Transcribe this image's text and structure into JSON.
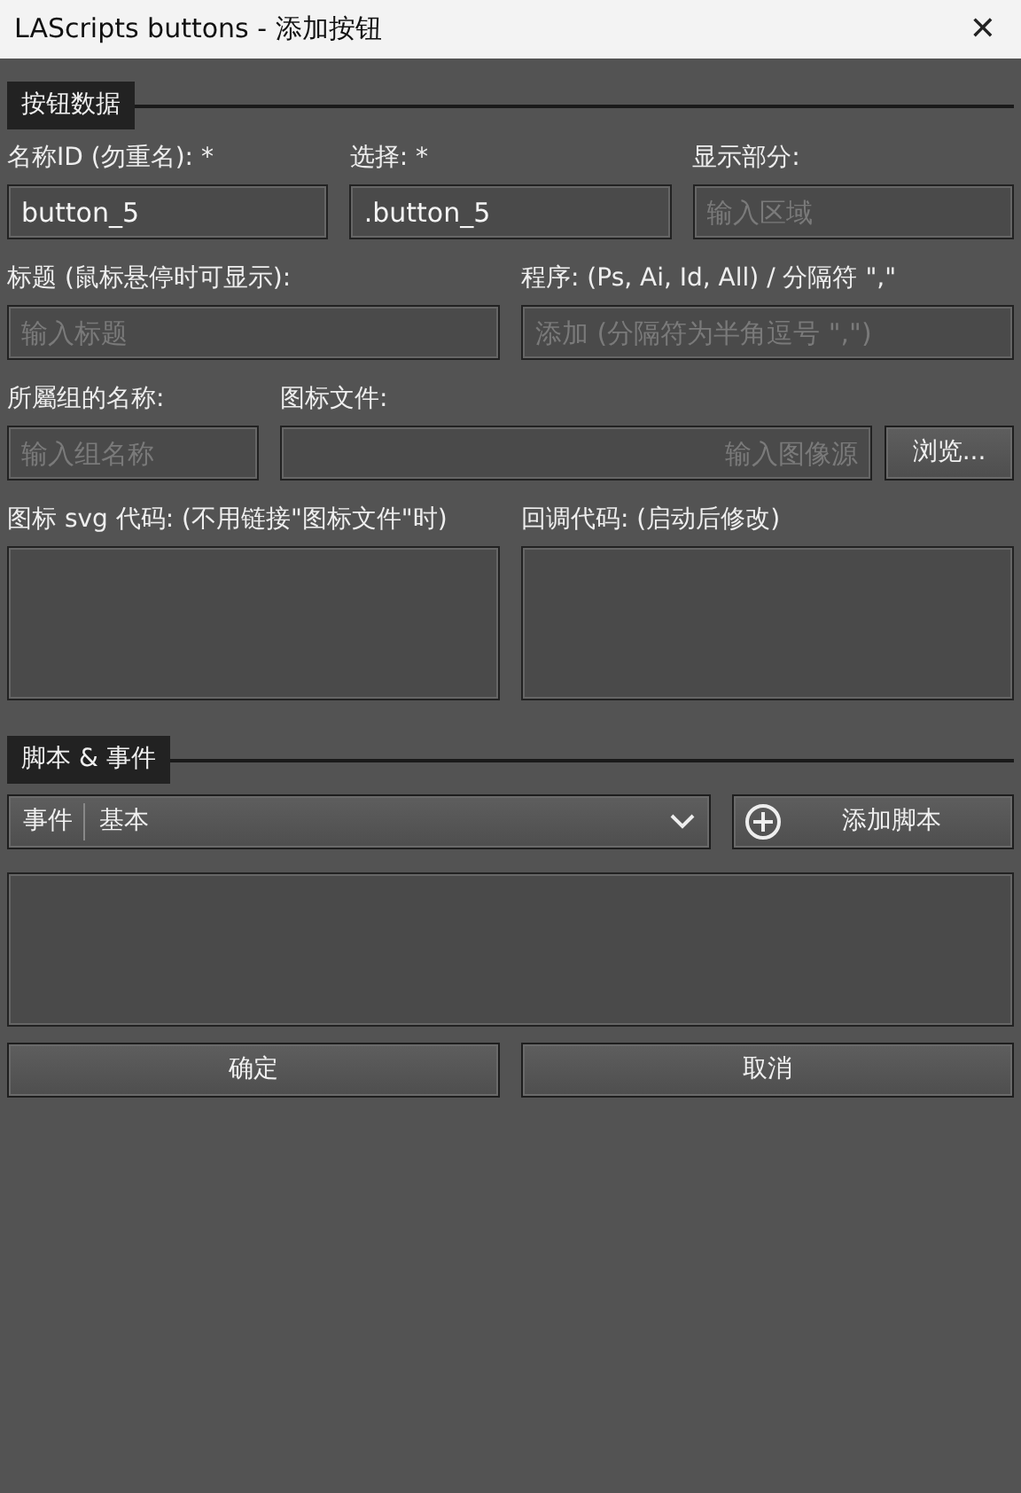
{
  "window": {
    "title": "LAScripts buttons - 添加按钮",
    "close": "✕"
  },
  "button_data": {
    "title": "按钮数据",
    "rows": [
      [
        {
          "kind": "input",
          "label": "名称ID (勿重名): *",
          "value": "button_5"
        },
        {
          "kind": "input",
          "label": "选择: *",
          "value": ".button_5"
        },
        {
          "kind": "input",
          "label": "显示部分:",
          "placeholder": "输入区域"
        }
      ],
      [
        {
          "kind": "input",
          "label": "标题 (鼠标悬停时可显示):",
          "placeholder": "输入标题"
        },
        {
          "kind": "input",
          "label": "程序: (Ps, Ai, Id, All) / 分隔符 \",\"",
          "placeholder": "添加 (分隔符为半角逗号 \",\")"
        }
      ],
      [
        {
          "kind": "input",
          "label": "所屬组的名称:",
          "placeholder": "输入组名称"
        },
        {
          "kind": "file",
          "label": "图标文件:",
          "placeholder": "输入图像源",
          "button": "浏览..."
        }
      ],
      [
        {
          "kind": "textarea",
          "label": "图标 svg 代码: (不用链接\"图标文件\"时)"
        },
        {
          "kind": "textarea",
          "label": "回调代码: (启动后修改)"
        }
      ]
    ]
  },
  "scripts": {
    "title": "脚本 & 事件",
    "select_label": "事件",
    "select_value": "基本",
    "add_button": "添加脚本"
  },
  "buttons": [
    "确定",
    "取消"
  ]
}
